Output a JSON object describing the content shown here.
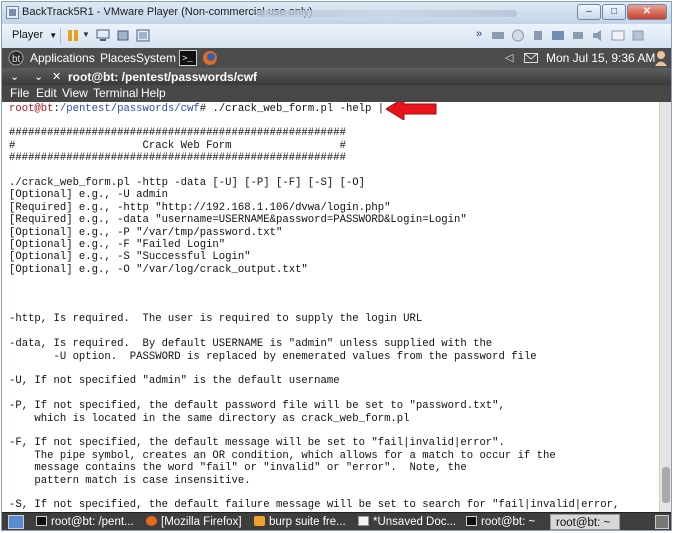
{
  "vmware": {
    "title": "BackTrack5R1 - VMware Player (Non-commercial use only)",
    "player_label": "Player",
    "window_buttons": {
      "minimize": "–",
      "maximize": "□",
      "close": "✕"
    }
  },
  "gnome_panel": {
    "applications": "Applications",
    "places": "Places",
    "system": "System",
    "datetime": "Mon Jul 15,  9:36 AM"
  },
  "terminal": {
    "title": "root@bt: /pentest/passwords/cwf",
    "title_controls": "⌄ ⌄ ✕",
    "menu": [
      "File",
      "Edit",
      "View",
      "Terminal",
      "Help"
    ],
    "prompt_user": "root@bt",
    "prompt_sep": ":",
    "prompt_path": "/pentest/passwords/cwf",
    "prompt_hash": "#",
    "command": " ./crack_web_form.pl -help | more",
    "lines": [
      "",
      "#####################################################",
      "#                    Crack Web Form                 #",
      "#####################################################",
      "",
      "./crack_web_form.pl -http -data [-U] [-P] [-F] [-S] [-O]",
      "[Optional] e.g., -U admin",
      "[Required] e.g., -http \"http://192.168.1.106/dvwa/login.php\"",
      "[Required] e.g., -data \"username=USERNAME&password=PASSWORD&Login=Login\"",
      "[Optional] e.g., -P \"/var/tmp/password.txt\"",
      "[Optional] e.g., -F \"Failed Login\"",
      "[Optional] e.g., -S \"Successful Login\"",
      "[Optional] e.g., -O \"/var/log/crack_output.txt\"",
      "",
      "",
      "",
      "-http, Is required.  The user is required to supply the login URL",
      "",
      "-data, Is required.  By default USERNAME is \"admin\" unless supplied with the",
      "       -U option.  PASSWORD is replaced by enemerated values from the password file",
      "",
      "-U, If not specified \"admin\" is the default username",
      "",
      "-P, If not specified, the default password file will be set to \"password.txt\",",
      "    which is located in the same directory as crack_web_form.pl",
      "",
      "-F, If not specified, the default message will be set to \"fail|invalid|error\".",
      "    The pipe symbol, creates an OR condition, which allows for a match to occur if the",
      "    message contains the word \"fail\" or \"invalid\" or \"error\".  Note, the",
      "    pattern match is case insensitive.",
      "",
      "-S, If not specified, the default failure message will be set to search for \"fail|invalid|error,"
    ]
  },
  "taskbar": {
    "items": [
      {
        "label": "root@bt: /pent...",
        "icon": "terminal-icon"
      },
      {
        "label": "[Mozilla Firefox]",
        "icon": "firefox-icon"
      },
      {
        "label": "burp suite fre...",
        "icon": "burp-icon"
      },
      {
        "label": "*Unsaved Doc...",
        "icon": "editor-icon"
      },
      {
        "label": "root@bt: ~",
        "icon": "terminal-icon"
      },
      {
        "label": "root@bt: ~",
        "icon": "none"
      }
    ]
  },
  "colors": {
    "annotation_arrow": "#e8141b",
    "prompt_user": "#c0111d",
    "prompt_path": "#2e49b9",
    "panel_bg": "#4c4c4c"
  }
}
